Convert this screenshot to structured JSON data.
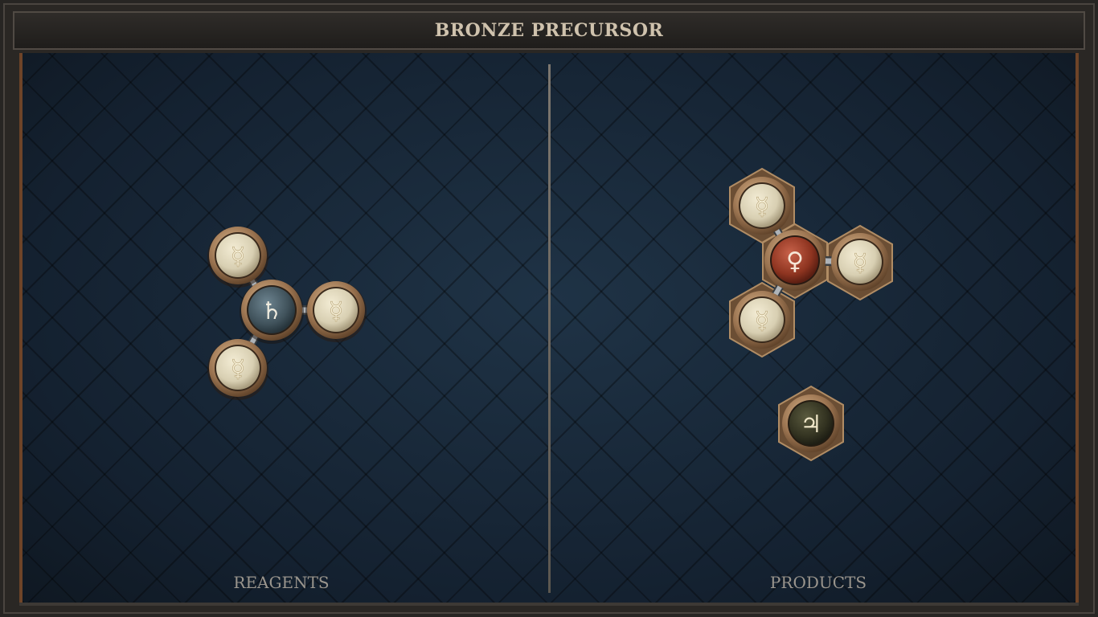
{
  "title": "BRONZE PRECURSOR",
  "panels": {
    "reagents_label": "REAGENTS",
    "products_label": "PRODUCTS"
  },
  "reagents": {
    "molecules": [
      {
        "atoms": [
          {
            "element": "lead",
            "symbol": "♄"
          },
          {
            "element": "quicksilver",
            "symbol": "☿"
          },
          {
            "element": "quicksilver",
            "symbol": "☿"
          },
          {
            "element": "quicksilver",
            "symbol": "☿"
          }
        ]
      }
    ]
  },
  "products": {
    "molecules": [
      {
        "atoms": [
          {
            "element": "copper",
            "symbol": "♀"
          },
          {
            "element": "quicksilver",
            "symbol": "☿"
          },
          {
            "element": "quicksilver",
            "symbol": "☿"
          },
          {
            "element": "quicksilver",
            "symbol": "☿"
          }
        ]
      },
      {
        "atoms": [
          {
            "element": "tin",
            "symbol": "♃"
          }
        ]
      }
    ]
  },
  "colors": {
    "board": "#1a2633",
    "bronze": "#8a6a4a",
    "quicksilver_atom": "#d9d0b4",
    "lead_atom": "#4a5a63",
    "copper_atom": "#9a3a24",
    "tin_atom": "#3a3a26",
    "symbol_light": "#f2e8c8",
    "symbol_dark": "#6a5a3a"
  }
}
